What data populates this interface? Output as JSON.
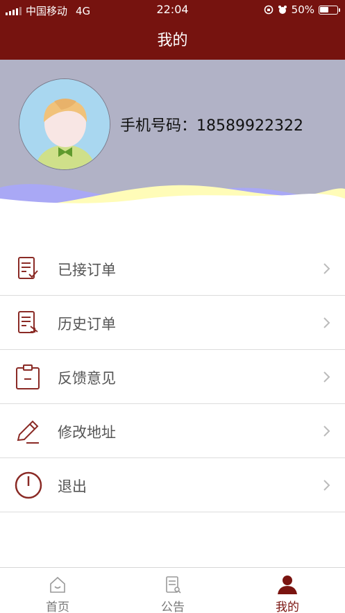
{
  "status_bar": {
    "carrier": "中国移动",
    "network": "4G",
    "time": "22:04",
    "battery_percent": "50%",
    "battery_level": 0.5
  },
  "header": {
    "title": "我的"
  },
  "profile": {
    "phone_text": "手机号码：18589922322"
  },
  "menu": {
    "items": [
      {
        "label": "已接订单",
        "icon": "accepted-orders-icon"
      },
      {
        "label": "历史订单",
        "icon": "history-orders-icon"
      },
      {
        "label": "反馈意见",
        "icon": "feedback-icon"
      },
      {
        "label": "修改地址",
        "icon": "edit-address-icon"
      },
      {
        "label": "退出",
        "icon": "power-icon"
      }
    ]
  },
  "tabbar": {
    "tabs": [
      {
        "label": "首页",
        "icon": "home-icon",
        "active": false
      },
      {
        "label": "公告",
        "icon": "notice-icon",
        "active": false
      },
      {
        "label": "我的",
        "icon": "profile-icon",
        "active": true
      }
    ]
  },
  "colors": {
    "brand": "#76130f",
    "profile_bg": "#b1b2c6",
    "icon": "#8a2a25",
    "wave_purple": "#a9a8f5",
    "wave_yellow": "#fffcb8"
  }
}
